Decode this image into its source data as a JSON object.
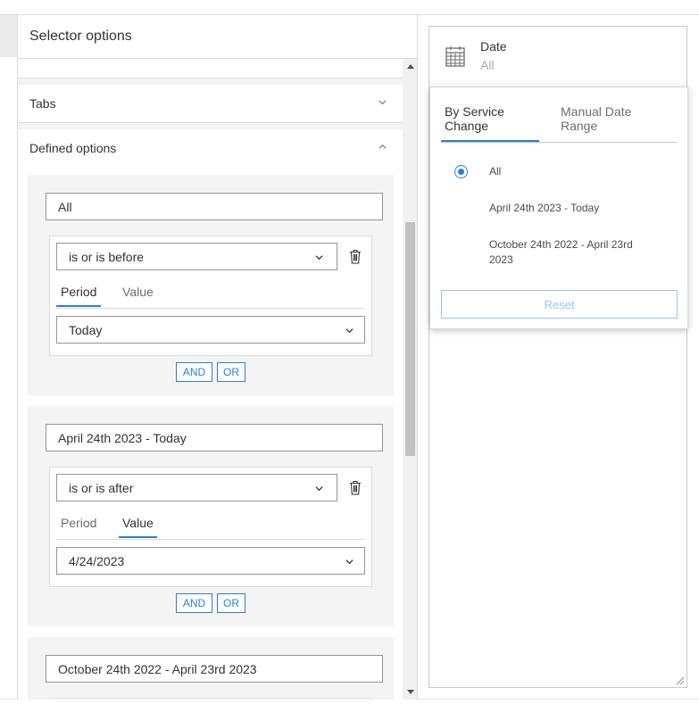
{
  "panel": {
    "title": "Selector options",
    "sections": {
      "tabs_label": "Tabs",
      "defined_label": "Defined options"
    }
  },
  "options": [
    {
      "name": "All",
      "operator": "is or is before",
      "segments": [
        "Period",
        "Value"
      ],
      "active_segment": "Period",
      "value": "Today",
      "logic": [
        "AND",
        "OR"
      ]
    },
    {
      "name": "April 24th 2023 - Today",
      "operator": "is or is after",
      "segments": [
        "Period",
        "Value"
      ],
      "active_segment": "Value",
      "value": "4/24/2023",
      "logic": [
        "AND",
        "OR"
      ]
    },
    {
      "name": "October 24th 2022 - April 23rd 2023"
    }
  ],
  "preview": {
    "title": "Date",
    "selected": "All",
    "tabs": [
      "By Service Change",
      "Manual Date Range"
    ],
    "active_tab": "By Service Change",
    "choices": [
      "All",
      "April 24th 2023 - Today",
      "October 24th 2022 - April 23rd 2023"
    ],
    "selected_choice": "All",
    "reset_label": "Reset"
  },
  "colors": {
    "accent": "#2b7fd0",
    "disabled_accent": "#9cc3ea",
    "card_bg": "#f4f4f4"
  },
  "icons": [
    "chevron-down-icon",
    "chevron-up-icon",
    "trash-icon",
    "calendar-icon",
    "resize-grip-icon"
  ]
}
